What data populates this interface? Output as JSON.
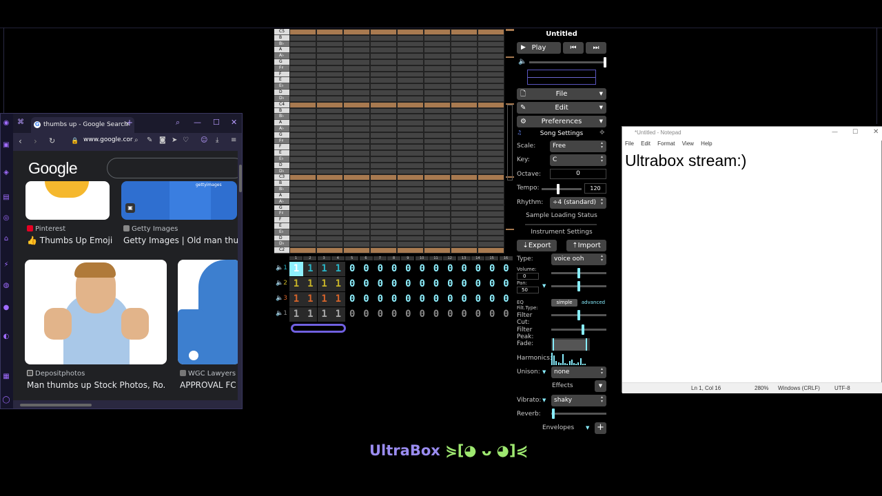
{
  "browser": {
    "tab_title": "thumbs up - Google Search",
    "url": "www.google.cor",
    "logo": "Google",
    "results": [
      {
        "source": "Pinterest",
        "title": "👍 Thumbs Up Emoji",
        "color": "#e60023"
      },
      {
        "source": "Getty Images",
        "title": "Getty Images | Old man thu...",
        "color": "#888888"
      },
      {
        "source": "Depositphotos",
        "title": "Man thumbs up Stock Photos, Ro...",
        "color": "#333333"
      },
      {
        "source": "WGC Lawyers",
        "title": "APPROVAL FC",
        "color": "#555555"
      }
    ],
    "getty_watermark": "gettyimages"
  },
  "piano": {
    "keys": [
      "C5",
      "B",
      "B♭",
      "A",
      "A♭",
      "G",
      "F♯",
      "F",
      "E",
      "E♭",
      "D",
      "D♭",
      "C4",
      "B",
      "B♭",
      "A",
      "A♭",
      "G",
      "F♯",
      "F",
      "E",
      "E♭",
      "D",
      "D♭",
      "C3",
      "B",
      "B♭",
      "A",
      "A♭",
      "G",
      "F♯",
      "F",
      "E",
      "E♭",
      "D",
      "D♭",
      "C2"
    ],
    "c_rows": [
      0,
      12,
      24,
      36
    ]
  },
  "pattern": {
    "bar_numbers": [
      "1",
      "2",
      "3",
      "4",
      "5",
      "6",
      "7",
      "8",
      "9",
      "10",
      "11",
      "12",
      "13",
      "14",
      "15",
      "16"
    ],
    "channels": [
      {
        "num": "1",
        "color": "#29b6c8",
        "values": [
          "1",
          "1",
          "1",
          "1",
          "0",
          "0",
          "0",
          "0",
          "0",
          "0",
          "0",
          "0",
          "0",
          "0",
          "0",
          "0"
        ]
      },
      {
        "num": "2",
        "color": "#c8b428",
        "values": [
          "1",
          "1",
          "1",
          "1",
          "0",
          "0",
          "0",
          "0",
          "0",
          "0",
          "0",
          "0",
          "0",
          "0",
          "0",
          "0"
        ]
      },
      {
        "num": "3",
        "color": "#d8642a",
        "values": [
          "1",
          "1",
          "1",
          "1",
          "0",
          "0",
          "0",
          "0",
          "0",
          "0",
          "0",
          "0",
          "0",
          "0",
          "0",
          "0"
        ]
      },
      {
        "num": "1",
        "color": "#888888",
        "values": [
          "1",
          "1",
          "1",
          "1",
          "0",
          "0",
          "0",
          "0",
          "0",
          "0",
          "0",
          "0",
          "0",
          "0",
          "0",
          "0"
        ]
      }
    ]
  },
  "panel": {
    "title": "Untitled",
    "play": "Play",
    "file": "File",
    "edit": "Edit",
    "preferences": "Preferences",
    "song_settings": "Song Settings",
    "scale_label": "Scale:",
    "scale_value": "Free",
    "key_label": "Key:",
    "key_value": "C",
    "octave_label": "Octave:",
    "octave_value": "0",
    "tempo_label": "Tempo:",
    "tempo_value": "120",
    "rhythm_label": "Rhythm:",
    "rhythm_value": "÷4 (standard)",
    "sample_status": "Sample Loading Status",
    "instrument_settings": "Instrument Settings",
    "export": "Export",
    "import": "Import",
    "type_label": "Type:",
    "type_value": "voice ooh",
    "volume_label": "Volume:",
    "volume_value": "0",
    "pan_label": "Pan:",
    "pan_value": "50",
    "eq_label": "EQ Filt.Type:",
    "eq_simple": "simple",
    "eq_advanced": "advanced",
    "filter_cut_label": "Filter Cut:",
    "filter_peak_label": "Filter Peak:",
    "fade_label": "Fade:",
    "harmonics_label": "Harmonics:",
    "unison_label": "Unison:",
    "unison_value": "none",
    "effects_label": "Effects",
    "vibrato_label": "Vibrato:",
    "vibrato_value": "shaky",
    "reverb_label": "Reverb:",
    "envelopes_label": "Envelopes"
  },
  "notepad": {
    "title": "*Untitled - Notepad",
    "menu": [
      "File",
      "Edit",
      "Format",
      "View",
      "Help"
    ],
    "content": "Ultrabox stream:)",
    "status_pos": "Ln 1, Col 16",
    "status_zoom": "280%",
    "status_eol": "Windows (CRLF)",
    "status_enc": "UTF-8"
  },
  "brand": {
    "name": "UltraBox",
    "face": "⋟[◕ ᴗ ◕]⋞"
  },
  "colors": {
    "accent": "#8ef0ff",
    "c_row": "#a87a50",
    "brand": "#9a8cf0"
  }
}
